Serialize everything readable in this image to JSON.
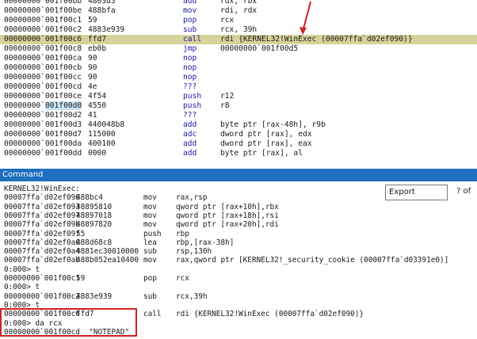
{
  "disasm": {
    "rows": [
      {
        "addr": "00000000`001f00bb",
        "bytes": "4803d3",
        "mnem": "add",
        "ops": "rdx, rbx"
      },
      {
        "addr": "00000000`001f00be",
        "bytes": "488bfa",
        "mnem": "mov",
        "ops": "rdi, rdx"
      },
      {
        "addr": "00000000`001f00c1",
        "bytes": "59",
        "mnem": "pop",
        "ops": "rcx"
      },
      {
        "addr": "00000000`001f00c2",
        "bytes": "4883e939",
        "mnem": "sub",
        "ops": "rcx, 39h"
      },
      {
        "addr": "00000000`001f00c6",
        "bytes": "ffd7",
        "mnem": "call",
        "ops": "rdi {KERNEL32!WinExec (00007ffa`d02ef090)}"
      },
      {
        "addr": "00000000`001f00c8",
        "bytes": "eb0b",
        "mnem": "jmp",
        "ops": "00000000`001f00d5"
      },
      {
        "addr": "00000000`001f00ca",
        "bytes": "90",
        "mnem": "nop",
        "ops": ""
      },
      {
        "addr": "00000000`001f00cb",
        "bytes": "90",
        "mnem": "nop",
        "ops": ""
      },
      {
        "addr": "00000000`001f00cc",
        "bytes": "90",
        "mnem": "nop",
        "ops": ""
      },
      {
        "addr": "00000000`001f00cd",
        "bytes": "4e",
        "mnem": "???",
        "ops": ""
      },
      {
        "addr": "00000000`001f00ce",
        "bytes": "4f54",
        "mnem": "push",
        "ops": "r12"
      },
      {
        "addr_pre": "00000000`",
        "addr_hl": "001f00d0",
        "bytes": "4550",
        "mnem": "push",
        "ops": "r8"
      },
      {
        "addr": "00000000`001f00d2",
        "bytes": "41",
        "mnem": "???",
        "ops": ""
      },
      {
        "addr": "00000000`001f00d3",
        "bytes": "440048b8",
        "mnem": "add",
        "ops": "byte ptr [rax-48h], r9b"
      },
      {
        "addr": "00000000`001f00d7",
        "bytes": "115000",
        "mnem": "adc",
        "ops": "dword ptr [rax], edx"
      },
      {
        "addr": "00000000`001f00da",
        "bytes": "400100",
        "mnem": "add",
        "ops": "dword ptr [rax], eax"
      },
      {
        "addr": "00000000`001f00dd",
        "bytes": "0000",
        "mnem": "add",
        "ops": "byte ptr [rax], al"
      }
    ],
    "current_row_index": 4,
    "arrow_color": "#d42020",
    "current_row_color": "#d6d39a"
  },
  "command": {
    "title": "Command",
    "export_label": "Export",
    "export_suffix": "? of",
    "lines": [
      {
        "kind": "text",
        "text": "KERNEL32!WinExec:"
      },
      {
        "kind": "asm",
        "addr": "00007ffa`d02ef090",
        "bytes": "488bc4",
        "mnem": "mov",
        "ops": "rax,rsp"
      },
      {
        "kind": "asm",
        "addr": "00007ffa`d02ef093",
        "bytes": "48895810",
        "mnem": "mov",
        "ops": "qword ptr [rax+10h],rbx"
      },
      {
        "kind": "asm",
        "addr": "00007ffa`d02ef097",
        "bytes": "48897018",
        "mnem": "mov",
        "ops": "qword ptr [rax+18h],rsi"
      },
      {
        "kind": "asm",
        "addr": "00007ffa`d02ef09b",
        "bytes": "48897820",
        "mnem": "mov",
        "ops": "qword ptr [rax+20h],rdi"
      },
      {
        "kind": "asm",
        "addr": "00007ffa`d02ef09f",
        "bytes": "55",
        "mnem": "push",
        "ops": "rbp"
      },
      {
        "kind": "asm",
        "addr": "00007ffa`d02ef0a0",
        "bytes": "488d68c8",
        "mnem": "lea",
        "ops": "rbp,[rax-38h]"
      },
      {
        "kind": "asm",
        "addr": "00007ffa`d02ef0a4",
        "bytes": "4881ec30010000",
        "mnem": "sub",
        "ops": "rsp,130h"
      },
      {
        "kind": "asm",
        "addr": "00007ffa`d02ef0ab",
        "bytes": "488b052ea10400",
        "mnem": "mov",
        "ops": "rax,qword ptr [KERNEL32!_security_cookie (00007ffa`d03391e0)]"
      },
      {
        "kind": "text",
        "text": "0:000> t"
      },
      {
        "kind": "asm2",
        "addr": "00000000`001f00c1",
        "bytes": "59",
        "mnem": "pop",
        "ops": "rcx"
      },
      {
        "kind": "text",
        "text": "0:000> t"
      },
      {
        "kind": "asm2",
        "addr": "00000000`001f00c2",
        "bytes": "4883e939",
        "mnem": "sub",
        "ops": "rcx,39h"
      },
      {
        "kind": "text",
        "text": "0:000> t"
      },
      {
        "kind": "asm2",
        "addr": "00000000`001f00c6",
        "bytes": "ffd7",
        "mnem": "call",
        "ops": "rdi {KERNEL32!WinExec (00007ffa`d02ef090)}"
      },
      {
        "kind": "text",
        "text": "0:000> da rcx"
      },
      {
        "kind": "text",
        "text": "00000000`001f00cd  \"NOTEPAD\""
      }
    ],
    "highlight_box_color": "#d42020",
    "title_bar_color": "#1e6fbf"
  }
}
